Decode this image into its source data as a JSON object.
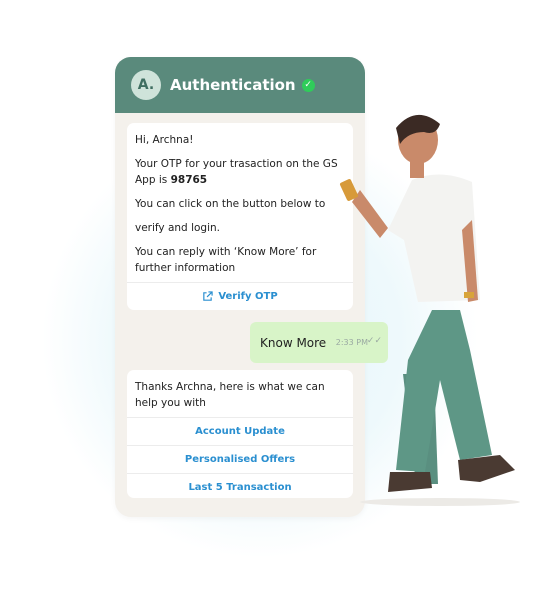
{
  "header": {
    "avatar_letter": "A.",
    "title": "Authentication"
  },
  "message1": {
    "greeting": "Hi, Archna!",
    "otp_prefix": "Your OTP for your trasaction on the GS App is ",
    "otp_code": "98765",
    "line_click": "You can click on the button below to",
    "line_verify": "verify and login.",
    "line_reply": "You can reply with ‘Know More’ for further information",
    "button_label": "Verify OTP"
  },
  "sent": {
    "text": "Know More",
    "time": "2:33 PM"
  },
  "message2": {
    "intro": "Thanks Archna, here is what we can help you with",
    "options": [
      "Account Update",
      "Personalised Offers",
      "Last 5 Transaction"
    ]
  },
  "colors": {
    "header_bg": "#5a8a7c",
    "link": "#2a8fd0",
    "sent_bubble": "#d8f4c8",
    "verified": "#2fcc5a"
  }
}
